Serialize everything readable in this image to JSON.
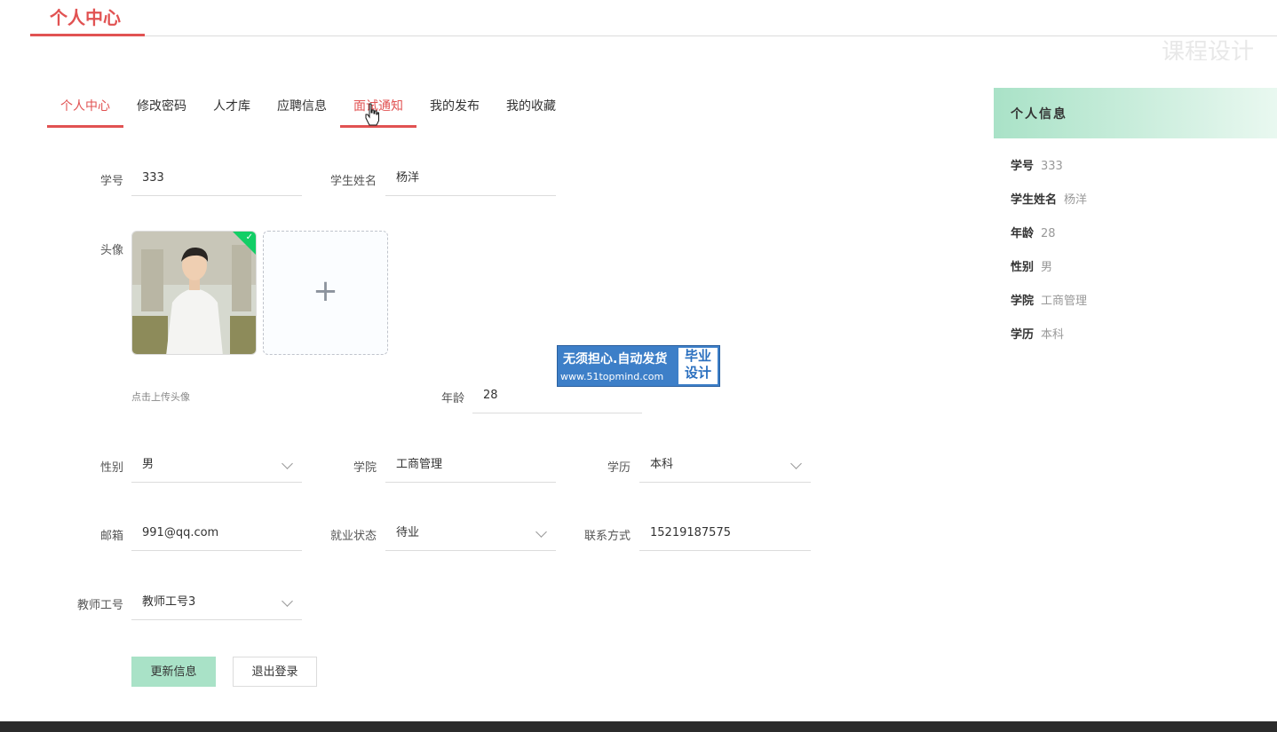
{
  "header": {
    "title": "个人中心",
    "watermark": "课程设计"
  },
  "tabs": [
    "个人中心",
    "修改密码",
    "人才库",
    "应聘信息",
    "面试通知",
    "我的发布",
    "我的收藏"
  ],
  "form": {
    "student_id": {
      "label": "学号",
      "value": "333"
    },
    "student_name": {
      "label": "学生姓名",
      "value": "杨洋"
    },
    "avatar": {
      "label": "头像",
      "upload_tip": "点击上传头像"
    },
    "age": {
      "label": "年龄",
      "value": "28"
    },
    "gender": {
      "label": "性别",
      "value": "男"
    },
    "college": {
      "label": "学院",
      "value": "工商管理"
    },
    "education": {
      "label": "学历",
      "value": "本科"
    },
    "email": {
      "label": "邮箱",
      "value": "991@qq.com"
    },
    "employment": {
      "label": "就业状态",
      "value": "待业"
    },
    "contact": {
      "label": "联系方式",
      "value": "15219187575"
    },
    "teacher_id": {
      "label": "教师工号",
      "value": "教师工号3"
    }
  },
  "buttons": {
    "update": "更新信息",
    "logout": "退出登录"
  },
  "promo": {
    "line1": "无须担心.自动发货",
    "line2": "www.51topmind.com",
    "badge1": "毕业",
    "badge2": "设计"
  },
  "side": {
    "title": "个人信息",
    "rows": [
      {
        "key": "学号",
        "value": "333"
      },
      {
        "key": "学生姓名",
        "value": "杨洋"
      },
      {
        "key": "年龄",
        "value": "28"
      },
      {
        "key": "性别",
        "value": "男"
      },
      {
        "key": "学院",
        "value": "工商管理"
      },
      {
        "key": "学历",
        "value": "本科"
      }
    ]
  },
  "colors": {
    "accent": "#e15252",
    "primary_button": "#a9e2c7",
    "panel_gradient_start": "#a9e2c7"
  }
}
